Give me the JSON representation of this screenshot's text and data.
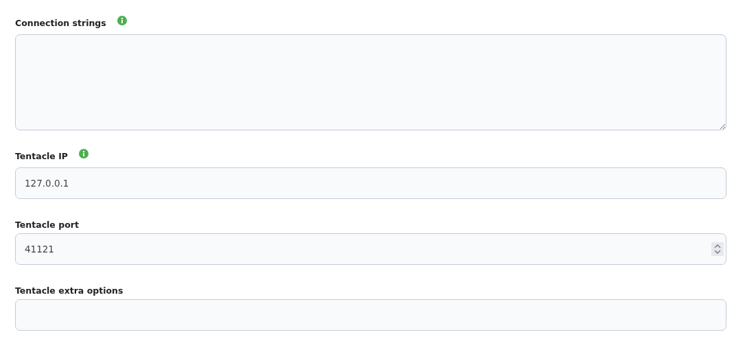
{
  "fields": [
    {
      "label": "Connection strings",
      "info": true,
      "kind": "textarea"
    },
    {
      "label": "Tentacle IP",
      "info": true,
      "kind": "text",
      "value": "127.0.0.1"
    },
    {
      "label": "Tentacle port",
      "info": false,
      "kind": "number",
      "value": "41121"
    },
    {
      "label": "Tentacle extra options",
      "info": false,
      "kind": "text"
    }
  ]
}
